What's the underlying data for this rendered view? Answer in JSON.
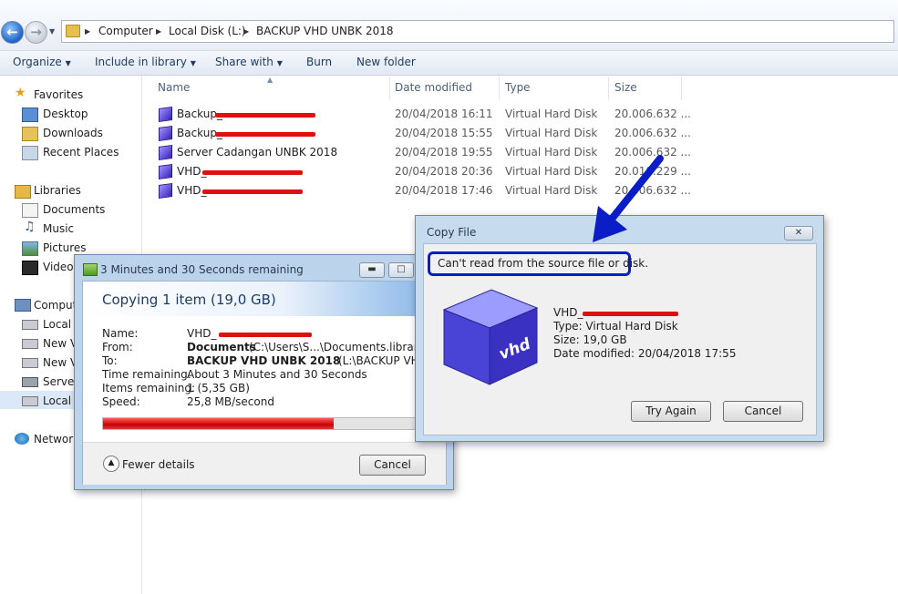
{
  "address": {
    "breadcrumbs": [
      "Computer",
      "Local Disk (L:)",
      "BACKUP VHD UNBK 2018"
    ]
  },
  "toolbar": {
    "organize": "Organize",
    "include_in_library": "Include in library",
    "share_with": "Share with",
    "burn": "Burn",
    "new_folder": "New folder"
  },
  "nav": {
    "favorites": "Favorites",
    "desktop": "Desktop",
    "downloads": "Downloads",
    "recent_places": "Recent Places",
    "libraries": "Libraries",
    "documents": "Documents",
    "music": "Music",
    "pictures": "Pictures",
    "videos": "Videos",
    "computer": "Comput",
    "local_disk_1": "Local D",
    "new_volume_1": "New V",
    "new_volume_2": "New V",
    "server": "Server",
    "local_disk_2": "Local D",
    "network": "Network"
  },
  "columns": {
    "name": "Name",
    "date_modified": "Date modified",
    "type": "Type",
    "size": "Size"
  },
  "files": [
    {
      "name": "Backup_",
      "date": "20/04/2018 16:11",
      "type": "Virtual Hard Disk",
      "size": "20.006.632 ..."
    },
    {
      "name": "Backup_",
      "date": "20/04/2018 15:55",
      "type": "Virtual Hard Disk",
      "size": "20.006.632 ..."
    },
    {
      "name": "Server Cadangan UNBK 2018",
      "date": "20/04/2018 19:55",
      "type": "Virtual Hard Disk",
      "size": "20.006.632 ..."
    },
    {
      "name": "VHD_",
      "date": "20/04/2018 20:36",
      "type": "Virtual Hard Disk",
      "size": "20.010.229 ..."
    },
    {
      "name": "VHD_",
      "date": "20/04/2018 17:46",
      "type": "Virtual Hard Disk",
      "size": "20.006.632 ..."
    }
  ],
  "copy_dialog": {
    "title": "3 Minutes and 30 Seconds remaining",
    "heading": "Copying 1 item (19,0 GB)",
    "name_label": "Name:",
    "name_value": "VHD_",
    "from_label": "From:",
    "from_bold": "Documents",
    "from_path": "(C:\\Users\\S...\\Documents.library-m",
    "to_label": "To:",
    "to_bold": "BACKUP VHD UNBK 2018",
    "to_path": "(L:\\BACKUP VHD U",
    "time_label": "Time remaining:",
    "time_value": "About 3 Minutes and 30 Seconds",
    "items_label": "Items remaining:",
    "items_value": "1 (5,35 GB)",
    "speed_label": "Speed:",
    "speed_value": "25,8 MB/second",
    "progress": 0.71,
    "fewer_details": "Fewer details",
    "cancel": "Cancel"
  },
  "error_dialog": {
    "title": "Copy File",
    "message": "Can't read from the source file or disk.",
    "file_name": "VHD_",
    "type": "Type: Virtual Hard Disk",
    "size": "Size: 19,0 GB",
    "date_modified": "Date modified: 20/04/2018 17:55",
    "cube_label": "vhd",
    "try_again": "Try Again",
    "cancel": "Cancel"
  },
  "colors": {
    "redaction": "#e01010",
    "highlight_box": "#0a1dc7",
    "annotation_arrow": "#0a1dc7",
    "progress_fill": "#d81010"
  }
}
